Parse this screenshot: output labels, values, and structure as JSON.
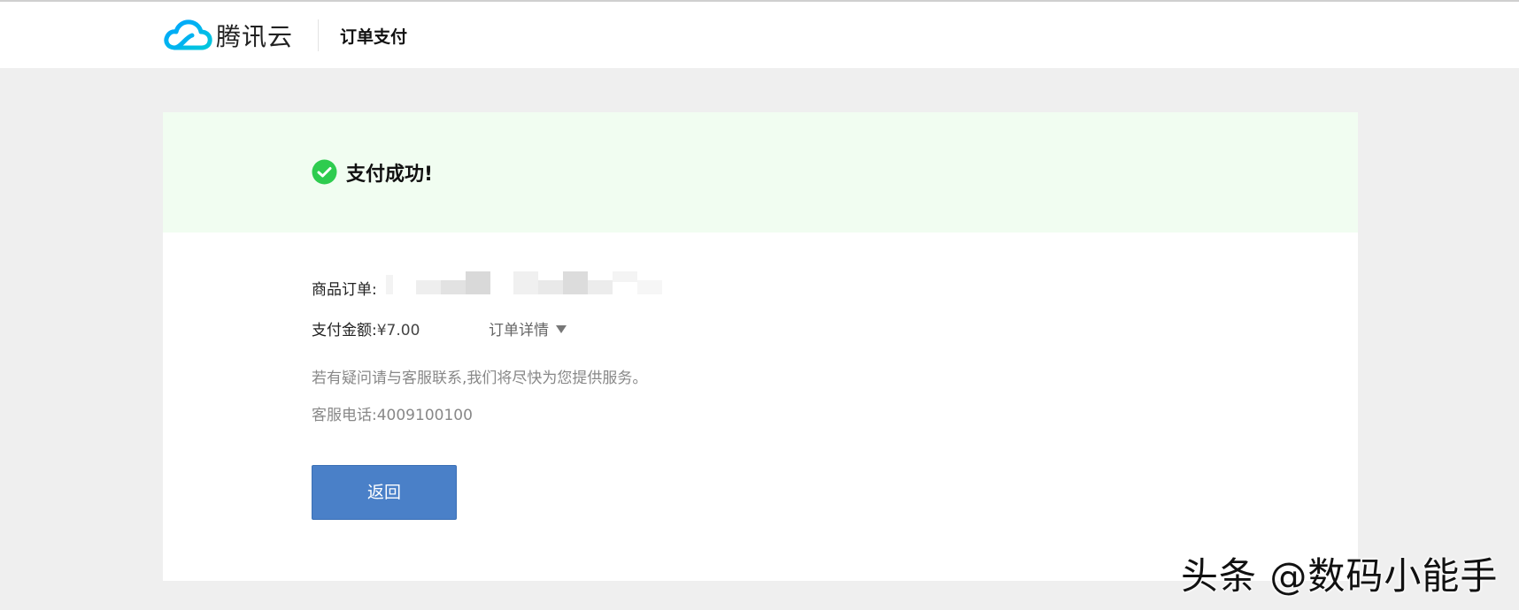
{
  "header": {
    "logo_text": "腾讯云",
    "page_title": "订单支付"
  },
  "status": {
    "message": "支付成功!"
  },
  "order": {
    "order_label": "商品订单:",
    "amount_label": "支付金额:",
    "amount_value": "¥7.00",
    "detail_link": "订单详情"
  },
  "help": {
    "contact_note": "若有疑问请与客服联系,我们将尽快为您提供服务。",
    "phone_label": "客服电话:",
    "phone_value": "4009100100"
  },
  "actions": {
    "back_label": "返回"
  },
  "watermark": {
    "text": "头条 @数码小能手"
  },
  "colors": {
    "accent": "#4a80c8",
    "success": "#2ecc4f",
    "banner_bg": "#f1fdf1",
    "page_bg": "#efefef"
  },
  "icons": {
    "logo": "cloud-logo-icon",
    "status": "check-circle-icon",
    "dropdown": "caret-down-icon"
  }
}
